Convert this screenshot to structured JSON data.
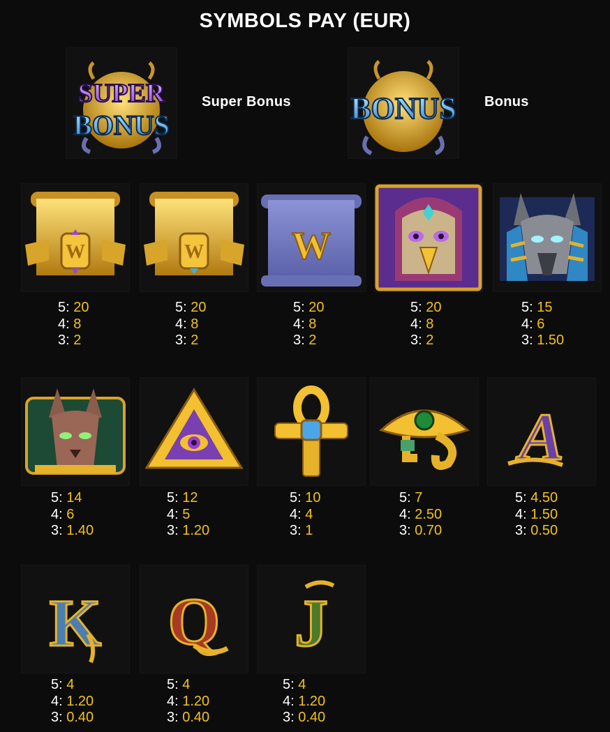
{
  "title": "SYMBOLS PAY (EUR)",
  "bonus_symbols": [
    {
      "id": "super-bonus",
      "label": "Super Bonus",
      "art_text": [
        "SUPER",
        "BONUS"
      ]
    },
    {
      "id": "bonus",
      "label": "Bonus",
      "art_text": [
        "BONUS"
      ]
    }
  ],
  "symbols": [
    {
      "id": "gold-wild-purple-scroll",
      "icon": "gold-wild-scroll-purple-gem-icon",
      "pays": [
        {
          "k": "5:",
          "v": "20"
        },
        {
          "k": "4:",
          "v": "8"
        },
        {
          "k": "3:",
          "v": "2"
        }
      ]
    },
    {
      "id": "gold-wild-blue-scroll",
      "icon": "gold-wild-scroll-blue-gem-icon",
      "pays": [
        {
          "k": "5:",
          "v": "20"
        },
        {
          "k": "4:",
          "v": "8"
        },
        {
          "k": "3:",
          "v": "2"
        }
      ]
    },
    {
      "id": "blue-wild-scroll",
      "icon": "blue-wild-scroll-icon",
      "art_text": "W",
      "pays": [
        {
          "k": "5:",
          "v": "20"
        },
        {
          "k": "4:",
          "v": "8"
        },
        {
          "k": "3:",
          "v": "2"
        }
      ]
    },
    {
      "id": "horus",
      "icon": "horus-falcon-icon",
      "pays": [
        {
          "k": "5:",
          "v": "20"
        },
        {
          "k": "4:",
          "v": "8"
        },
        {
          "k": "3:",
          "v": "2"
        }
      ]
    },
    {
      "id": "anubis",
      "icon": "anubis-jackal-icon",
      "pays": [
        {
          "k": "5:",
          "v": "15"
        },
        {
          "k": "4:",
          "v": "6"
        },
        {
          "k": "3:",
          "v": "1.50"
        }
      ]
    },
    {
      "id": "bastet",
      "icon": "bastet-cat-icon",
      "pays": [
        {
          "k": "5:",
          "v": "14"
        },
        {
          "k": "4:",
          "v": "6"
        },
        {
          "k": "3:",
          "v": "1.40"
        }
      ]
    },
    {
      "id": "eye-pyramid",
      "icon": "eye-pyramid-icon",
      "pays": [
        {
          "k": "5:",
          "v": "12"
        },
        {
          "k": "4:",
          "v": "5"
        },
        {
          "k": "3:",
          "v": "1.20"
        }
      ]
    },
    {
      "id": "ankh",
      "icon": "ankh-icon",
      "pays": [
        {
          "k": "5:",
          "v": "10"
        },
        {
          "k": "4:",
          "v": "4"
        },
        {
          "k": "3:",
          "v": "1"
        }
      ]
    },
    {
      "id": "eye-of-ra",
      "icon": "eye-of-ra-icon",
      "pays": [
        {
          "k": "5:",
          "v": "7"
        },
        {
          "k": "4:",
          "v": "2.50"
        },
        {
          "k": "3:",
          "v": "0.70"
        }
      ]
    },
    {
      "id": "letter-a",
      "icon": "letter-a-icon",
      "art_text": "A",
      "pays": [
        {
          "k": "5:",
          "v": "4.50"
        },
        {
          "k": "4:",
          "v": "1.50"
        },
        {
          "k": "3:",
          "v": "0.50"
        }
      ]
    },
    {
      "id": "letter-k",
      "icon": "letter-k-icon",
      "art_text": "K",
      "pays": [
        {
          "k": "5:",
          "v": "4"
        },
        {
          "k": "4:",
          "v": "1.20"
        },
        {
          "k": "3:",
          "v": "0.40"
        }
      ]
    },
    {
      "id": "letter-q",
      "icon": "letter-q-icon",
      "art_text": "Q",
      "pays": [
        {
          "k": "5:",
          "v": "4"
        },
        {
          "k": "4:",
          "v": "1.20"
        },
        {
          "k": "3:",
          "v": "0.40"
        }
      ]
    },
    {
      "id": "letter-j",
      "icon": "letter-j-icon",
      "art_text": "J",
      "pays": [
        {
          "k": "5:",
          "v": "4"
        },
        {
          "k": "4:",
          "v": "1.20"
        },
        {
          "k": "3:",
          "v": "0.40"
        }
      ]
    }
  ],
  "colors": {
    "background": "#0c0c0c",
    "pay_key": "#ffffff",
    "pay_value": "#f4c21a",
    "gold": "#e9b824",
    "purple": "#6a3fa8",
    "blue": "#6d74b8"
  }
}
